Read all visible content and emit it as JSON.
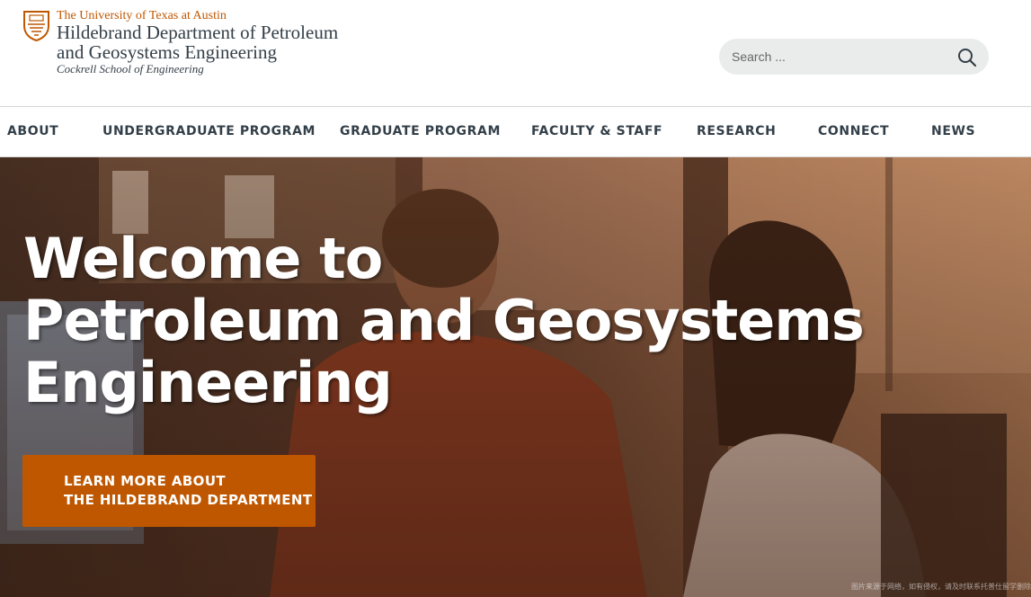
{
  "header": {
    "university": "The University of Texas at Austin",
    "department_line1": "Hildebrand Department of Petroleum",
    "department_line2": "and Geosystems Engineering",
    "school": "Cockrell School of Engineering",
    "logo_icon": "ut-seal-icon"
  },
  "search": {
    "placeholder": "Search ...",
    "value": "",
    "icon": "search-icon"
  },
  "nav": {
    "items": [
      {
        "label": "ABOUT"
      },
      {
        "label": "UNDERGRADUATE PROGRAM"
      },
      {
        "label": "GRADUATE PROGRAM"
      },
      {
        "label": "FACULTY & STAFF"
      },
      {
        "label": "RESEARCH"
      },
      {
        "label": "CONNECT"
      },
      {
        "label": "NEWS"
      }
    ]
  },
  "hero": {
    "title_line1": "Welcome to",
    "title_line2": "Petroleum and Geosystems",
    "title_line3": "Engineering",
    "cta_line1": "LEARN MORE ABOUT",
    "cta_line2": "THE HILDEBRAND DEPARTMENT",
    "watermark": "图片来源于网络，如有侵权，请及时联系托普仕留学删除"
  },
  "colors": {
    "brand_orange": "#bf5700",
    "text_dark": "#333f48",
    "search_bg": "#eaecec"
  }
}
